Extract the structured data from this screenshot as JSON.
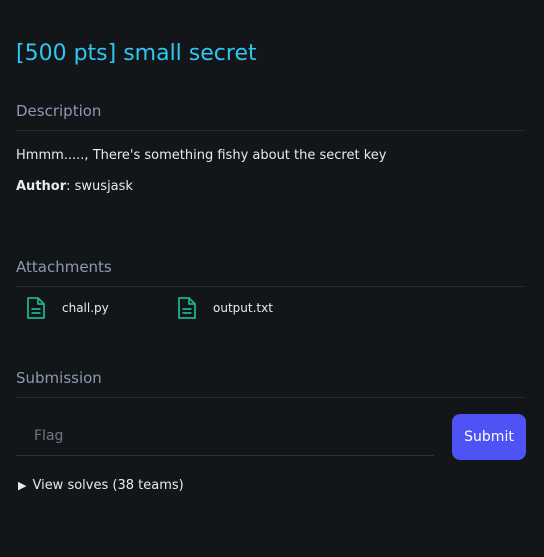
{
  "challenge": {
    "title": "[500 pts] small secret"
  },
  "description": {
    "heading": "Description",
    "text": "Hmmm....., There's something fishy about the secret key",
    "author_label": "Author",
    "author_sep": ": ",
    "author_name": "swusjask"
  },
  "attachments": {
    "heading": "Attachments",
    "files": [
      {
        "name": "chall.py",
        "icon": "file-text-icon"
      },
      {
        "name": "output.txt",
        "icon": "file-text-icon"
      }
    ]
  },
  "submission": {
    "heading": "Submission",
    "placeholder": "Flag",
    "submit_label": "Submit"
  },
  "solves": {
    "toggle_glyph": "▶",
    "label": "View solves (38 teams)"
  },
  "colors": {
    "background": "#121619",
    "title": "#2ec6f2",
    "heading": "#8d99b2",
    "icon": "#1fb08e",
    "button": "#4f52f5"
  }
}
